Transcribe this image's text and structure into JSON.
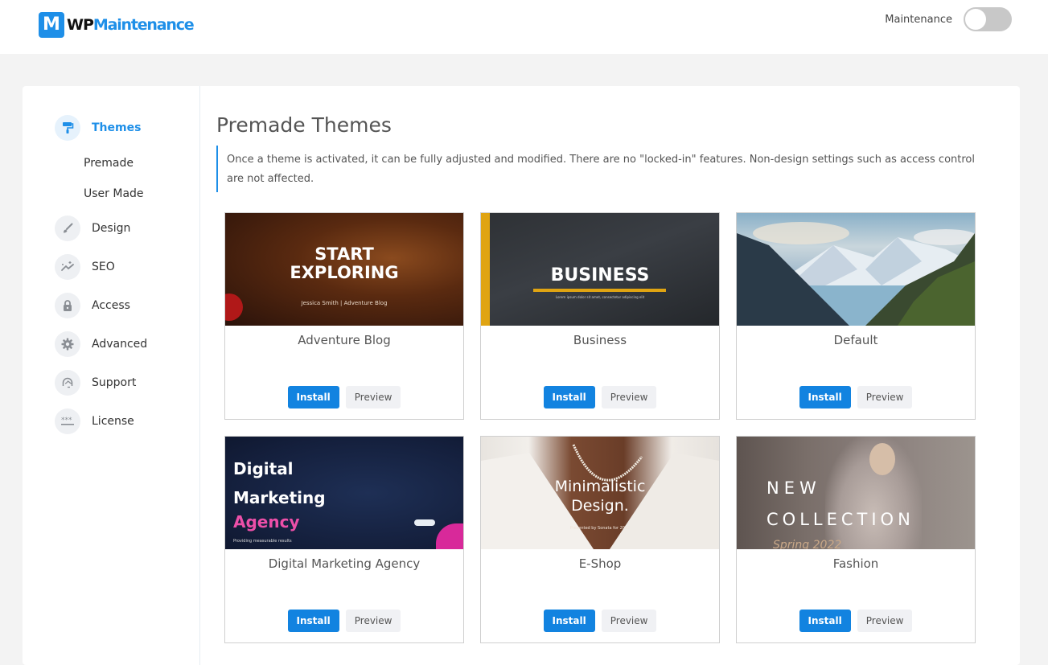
{
  "header": {
    "logo_badge": "M",
    "logo_prefix": "WP",
    "logo_suffix": "Maintenance",
    "maintenance_label": "Maintenance",
    "maintenance_enabled": false
  },
  "sidebar": {
    "items": [
      {
        "label": "Themes",
        "icon": "paint-roller-icon",
        "active": true
      },
      {
        "label": "Design",
        "icon": "brush-icon",
        "active": false
      },
      {
        "label": "SEO",
        "icon": "trend-sparkle-icon",
        "active": false
      },
      {
        "label": "Access",
        "icon": "lock-icon",
        "active": false
      },
      {
        "label": "Advanced",
        "icon": "gear-icon",
        "active": false
      },
      {
        "label": "Support",
        "icon": "support-agent-icon",
        "active": false
      },
      {
        "label": "License",
        "icon": "password-icon",
        "active": false
      }
    ],
    "subitems": [
      {
        "label": "Premade"
      },
      {
        "label": "User Made"
      }
    ]
  },
  "main": {
    "title": "Premade Themes",
    "notice": "Once a theme is activated, it can be fully adjusted and modified. There are no \"locked-in\" features. Non-design settings such as access control are not affected.",
    "install_label": "Install",
    "preview_label": "Preview",
    "themes": [
      {
        "name": "Adventure Blog",
        "thumb_title": "START EXPLORING",
        "thumb_sub": "Jessica Smith | Adventure Blog"
      },
      {
        "name": "Business",
        "thumb_title": "BUSINESS",
        "thumb_sub": "Lorem ipsum dolor sit amet, consectetur adipiscing elit"
      },
      {
        "name": "Default",
        "thumb_title": "",
        "thumb_sub": ""
      },
      {
        "name": "Digital Marketing Agency",
        "thumb_title": "Digital Marketing",
        "thumb_title2": "Agency",
        "thumb_sub": "Providing measurable results"
      },
      {
        "name": "E-Shop",
        "thumb_title": "Minimalistic Design.",
        "thumb_sub": "Presented by Sonata for 2022"
      },
      {
        "name": "Fashion",
        "thumb_title": "NEW",
        "thumb_title2": "COLLECTION",
        "thumb_sub": "Spring 2022"
      }
    ]
  },
  "colors": {
    "accent": "#1e8fe8",
    "install_button": "#1283e0",
    "page_background": "#f3f3f3",
    "toggle_off": "#c8c8c8"
  }
}
